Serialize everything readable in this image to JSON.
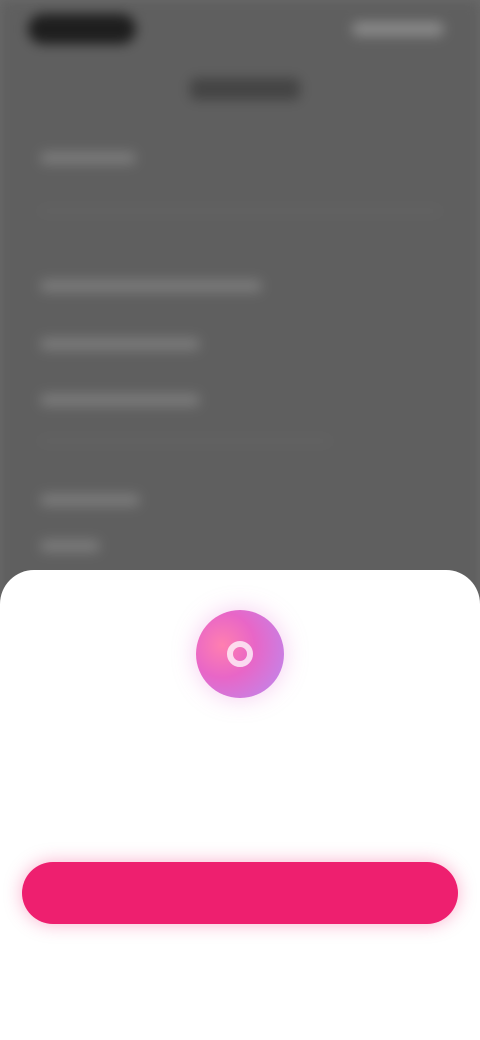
{
  "colors": {
    "accent": "#ee1f6f",
    "avatar_pink": "#ff7fb0",
    "avatar_purple": "#b98cf2",
    "overlay": "#6b6b6b"
  },
  "icons": {
    "avatar": "app-logo-icon"
  },
  "sheet": {
    "title": "",
    "body": "",
    "primary_label": "",
    "secondary_label": ""
  }
}
